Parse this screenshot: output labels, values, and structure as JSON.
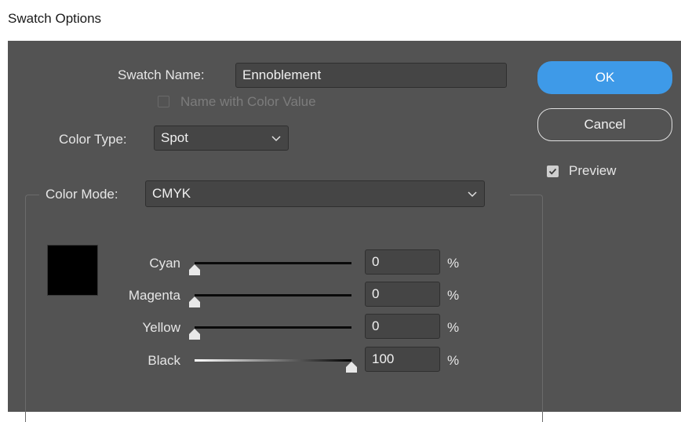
{
  "window": {
    "title": "Swatch Options"
  },
  "swatch_name": {
    "label": "Swatch Name:",
    "value": "Ennoblement"
  },
  "name_with_color_value": {
    "label": "Name with Color Value",
    "checked": false,
    "disabled": true
  },
  "color_type": {
    "label": "Color Type:",
    "value": "Spot"
  },
  "color_mode": {
    "label": "Color Mode:",
    "value": "CMYK"
  },
  "swatch_preview": {
    "color": "#000000"
  },
  "sliders": [
    {
      "label": "Cyan",
      "value": "0",
      "unit": "%",
      "fraction": 0.0
    },
    {
      "label": "Magenta",
      "value": "0",
      "unit": "%",
      "fraction": 0.0
    },
    {
      "label": "Yellow",
      "value": "0",
      "unit": "%",
      "fraction": 0.0
    },
    {
      "label": "Black",
      "value": "100",
      "unit": "%",
      "fraction": 1.0
    }
  ],
  "buttons": {
    "ok": "OK",
    "cancel": "Cancel"
  },
  "preview": {
    "label": "Preview",
    "checked": true
  },
  "colors": {
    "dialog_bg": "#535353",
    "accent": "#3e9ae8",
    "field_bg": "#454545"
  },
  "icons": {
    "dropdown": "chevron-down-icon",
    "check": "checkmark-icon",
    "slider": "slider-thumb-icon"
  }
}
